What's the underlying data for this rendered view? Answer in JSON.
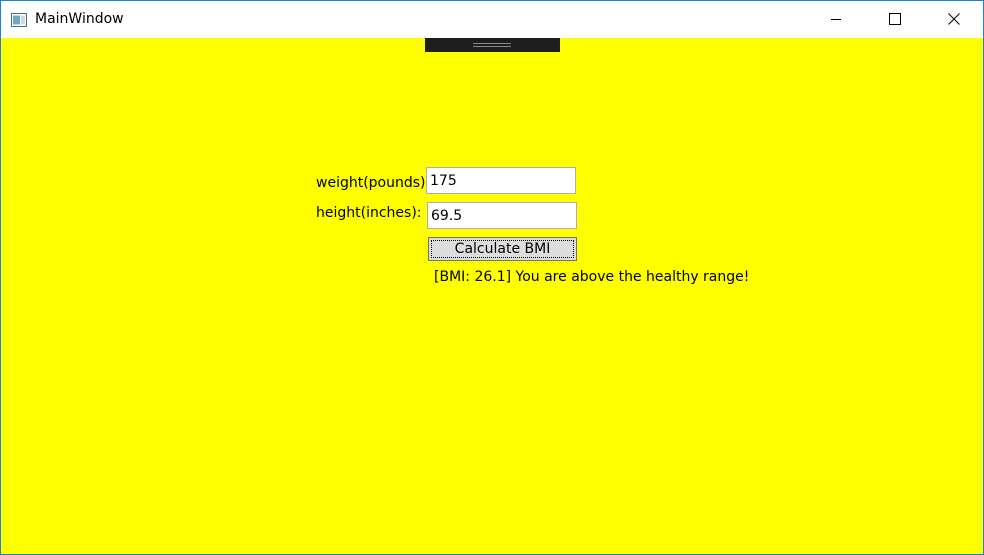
{
  "window": {
    "title": "MainWindow",
    "app_icon": "window-app-icon",
    "controls": {
      "minimize_icon": "minimize-icon",
      "maximize_icon": "maximize-icon",
      "close_icon": "close-icon"
    }
  },
  "colors": {
    "background": "#ffff00",
    "titlebar": "#ffffff",
    "border_accent": "#1883d7",
    "button_face": "#dddddd"
  },
  "form": {
    "weight_label": "weight(pounds):",
    "weight_value": "175",
    "height_label": "height(inches):",
    "height_value": "69.5",
    "calculate_label": "Calculate BMI",
    "result_text": "[BMI: 26.1] You are above the healthy range!"
  }
}
